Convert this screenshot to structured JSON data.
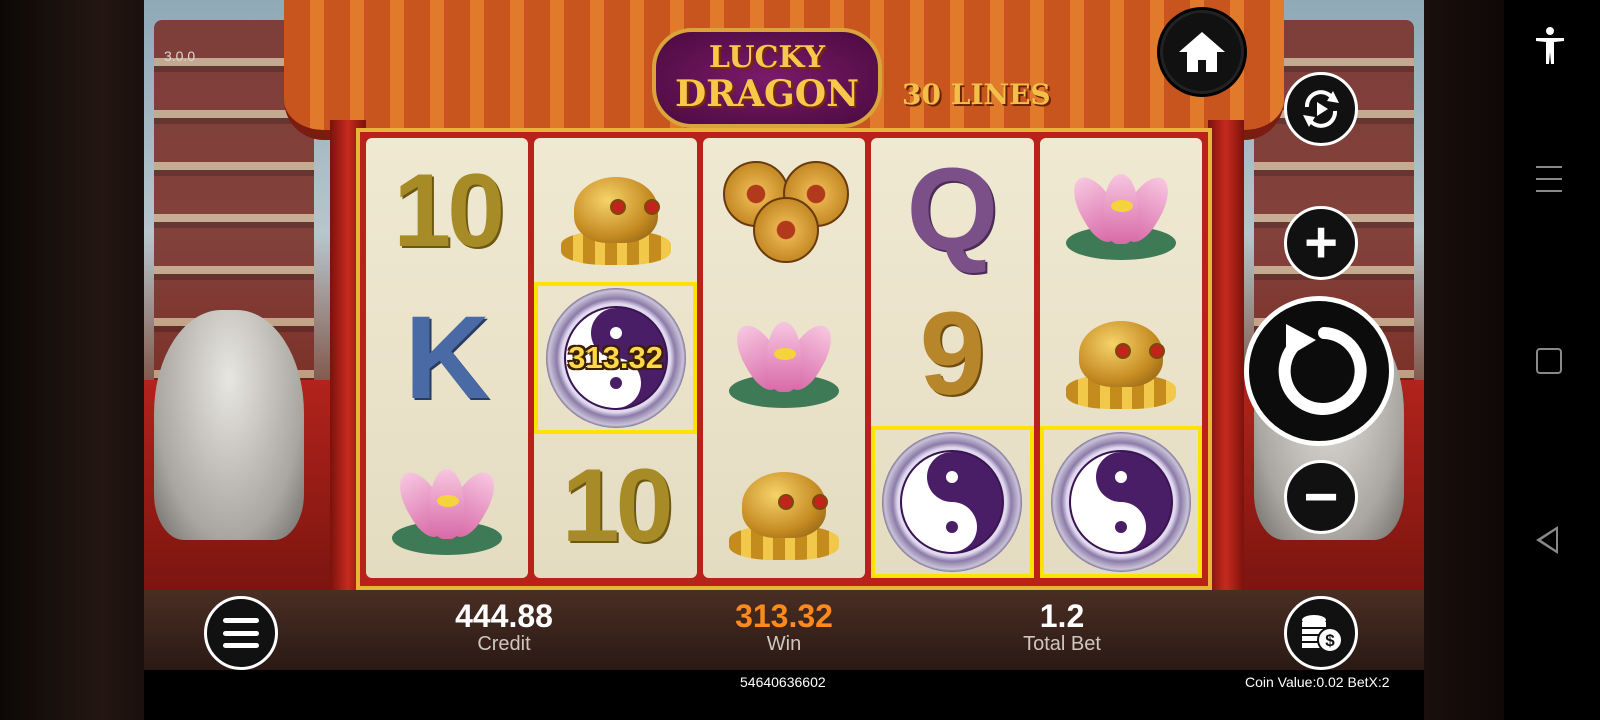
{
  "game": {
    "version": "3.0.0",
    "logo_line1": "LUCKY",
    "logo_line2": "DRAGON",
    "lines_label": "30 LINES",
    "win_overlay": "313.32"
  },
  "reels": [
    [
      {
        "symbol": "10",
        "win": false
      },
      {
        "symbol": "K",
        "win": false
      },
      {
        "symbol": "lotus",
        "win": false
      }
    ],
    [
      {
        "symbol": "toad",
        "win": false
      },
      {
        "symbol": "yinyang",
        "win": true,
        "overlay": "313.32"
      },
      {
        "symbol": "10",
        "win": false
      }
    ],
    [
      {
        "symbol": "coins",
        "win": false
      },
      {
        "symbol": "lotus",
        "win": false
      },
      {
        "symbol": "toad",
        "win": false
      }
    ],
    [
      {
        "symbol": "Q",
        "win": false
      },
      {
        "symbol": "9",
        "win": false
      },
      {
        "symbol": "yinyang",
        "win": true
      }
    ],
    [
      {
        "symbol": "lotus",
        "win": false
      },
      {
        "symbol": "toad",
        "win": false
      },
      {
        "symbol": "yinyang",
        "win": true
      }
    ]
  ],
  "stats": {
    "credit_value": "444.88",
    "credit_label": "Credit",
    "win_value": "313.32",
    "win_label": "Win",
    "total_bet_value": "1.2",
    "total_bet_label": "Total Bet"
  },
  "footer": {
    "round_id": "54640636602",
    "coin_info": "Coin Value:0.02  BetX:2"
  },
  "controls": {
    "home": "home-icon",
    "autoplay": "autoplay-icon",
    "increase": "+",
    "spin": "spin-icon",
    "decrease": "−",
    "menu": "menu-icon",
    "bet": "coins-icon"
  },
  "colors": {
    "win_highlight": "#ffe200",
    "win_value": "#ff8a1c",
    "reel_frame": "#b8221a"
  }
}
